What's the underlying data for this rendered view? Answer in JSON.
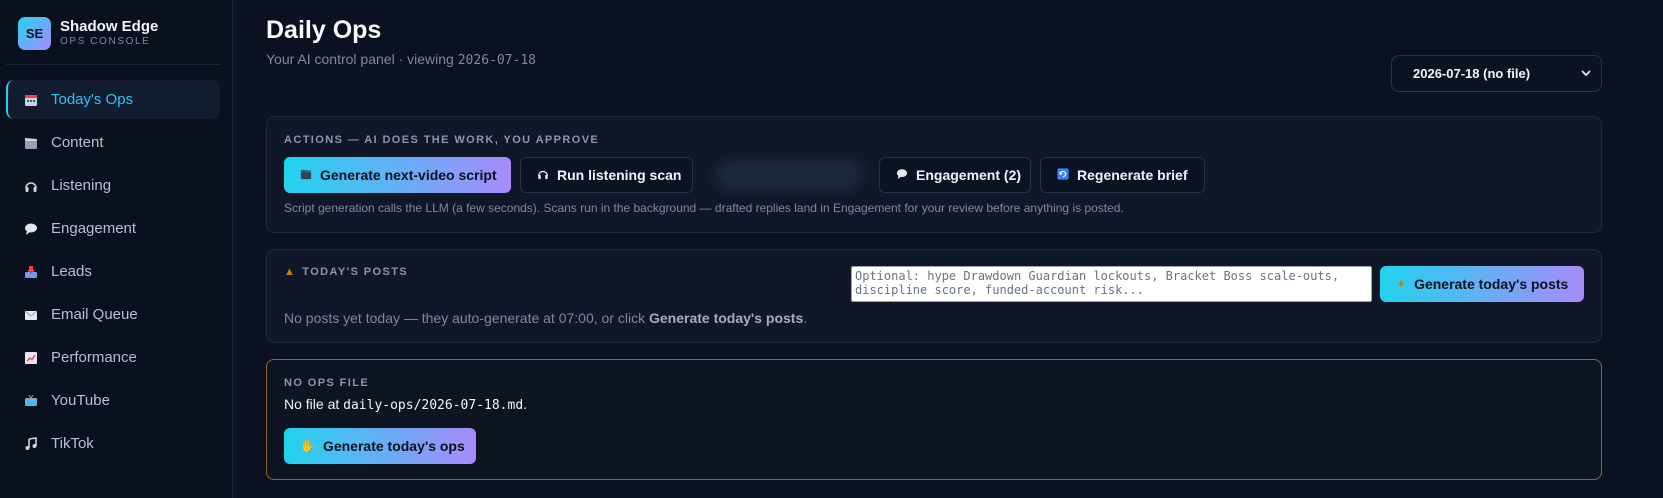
{
  "brand": {
    "initials": "SE",
    "name": "Shadow Edge",
    "subtitle": "OPS CONSOLE"
  },
  "sidebar": {
    "items": [
      {
        "label": "Today's Ops",
        "icon": "calendar-icon",
        "active": true
      },
      {
        "label": "Content",
        "icon": "clapperboard-icon"
      },
      {
        "label": "Listening",
        "icon": "headphones-icon"
      },
      {
        "label": "Engagement",
        "icon": "speech-bubble-icon"
      },
      {
        "label": "Leads",
        "icon": "inbox-tray-icon"
      },
      {
        "label": "Email Queue",
        "icon": "envelope-icon"
      },
      {
        "label": "Performance",
        "icon": "trend-chart-icon"
      },
      {
        "label": "YouTube",
        "icon": "tv-icon"
      },
      {
        "label": "TikTok",
        "icon": "music-note-icon"
      }
    ]
  },
  "header": {
    "title": "Daily Ops",
    "subtitle_prefix": "Your AI control panel · viewing ",
    "subtitle_date": "2026-07-18",
    "date_select_value": "2026-07-18 (no file)"
  },
  "actions": {
    "label": "ACTIONS — AI DOES THE WORK, YOU APPROVE",
    "buttons": {
      "script": "Generate next-video script",
      "scan": "Run listening scan",
      "engagement": "Engagement (2)",
      "brief": "Regenerate brief"
    },
    "hint": "Script generation calls the LLM (a few seconds). Scans run in the background — drafted replies land in Engagement for your review before anything is posted."
  },
  "posts": {
    "label": "TODAY'S POSTS",
    "input_placeholder": "Optional: hype Drawdown Guardian lockouts, Bracket Boss scale-outs, discipline score, funded-account risk...",
    "button": "Generate today's posts",
    "empty_prefix": "No posts yet today — they auto-generate at 07:00, or click ",
    "empty_link": "Generate today's posts",
    "empty_suffix": "."
  },
  "noops": {
    "label": "NO OPS FILE",
    "text_prefix": "No file at ",
    "path": "daily-ops/2026-07-18.md",
    "text_suffix": ".",
    "button": "Generate today's ops"
  },
  "colors": {
    "accent_start": "#22d3ee",
    "accent_end": "#a78bfa",
    "warning_border": "#8a6a24",
    "background": "#0b1120"
  }
}
